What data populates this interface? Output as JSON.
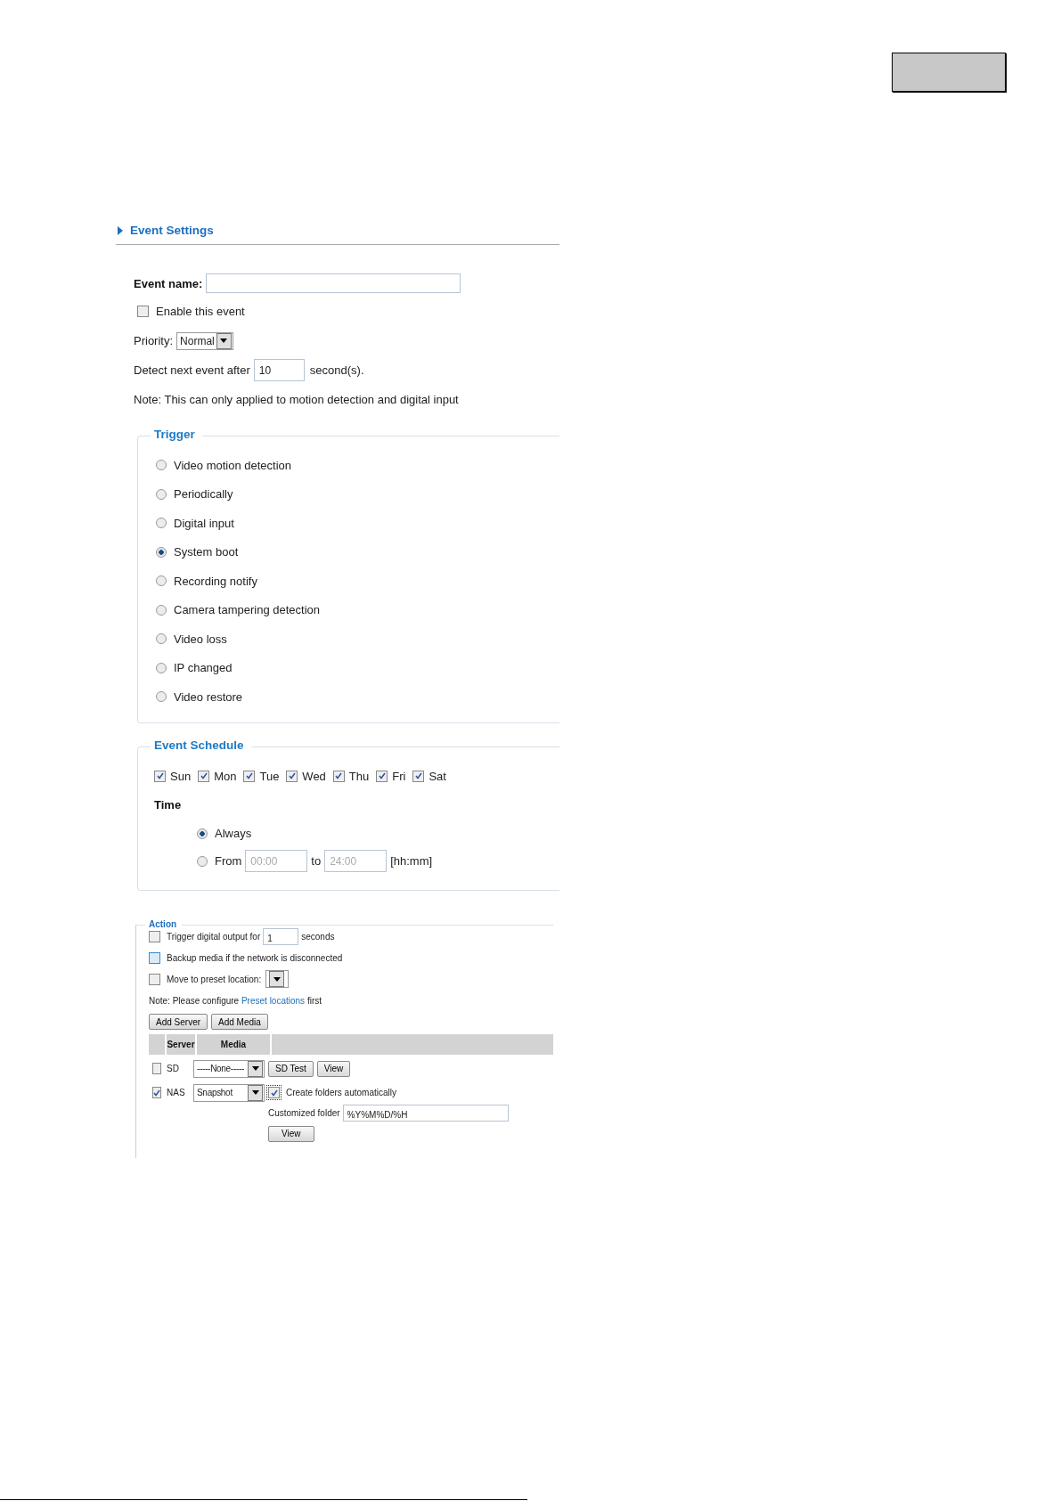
{
  "header": {
    "title": "Event Settings"
  },
  "event_name": {
    "label": "Event name:"
  },
  "enable_event": {
    "label": "Enable this event",
    "checked": false
  },
  "priority": {
    "label": "Priority:",
    "value": "Normal"
  },
  "detect_next": {
    "label": "Detect next event after",
    "value": "10",
    "unit": "second(s)."
  },
  "note": "Note: This can only applied to motion detection and digital input",
  "trigger": {
    "title": "Trigger",
    "options": [
      {
        "label": "Video motion detection",
        "selected": false
      },
      {
        "label": "Periodically",
        "selected": false
      },
      {
        "label": "Digital input",
        "selected": false
      },
      {
        "label": "System boot",
        "selected": true
      },
      {
        "label": "Recording notify",
        "selected": false
      },
      {
        "label": "Camera tampering detection",
        "selected": false
      },
      {
        "label": "Video loss",
        "selected": false
      },
      {
        "label": "IP changed",
        "selected": false
      },
      {
        "label": "Video restore",
        "selected": false
      }
    ]
  },
  "schedule": {
    "title": "Event Schedule",
    "days": [
      {
        "label": "Sun",
        "checked": true
      },
      {
        "label": "Mon",
        "checked": true
      },
      {
        "label": "Tue",
        "checked": true
      },
      {
        "label": "Wed",
        "checked": true
      },
      {
        "label": "Thu",
        "checked": true
      },
      {
        "label": "Fri",
        "checked": true
      },
      {
        "label": "Sat",
        "checked": true
      }
    ],
    "time_label": "Time",
    "modes": [
      {
        "kind": "always",
        "label": "Always",
        "selected": true
      },
      {
        "kind": "range",
        "label": "From",
        "selected": false,
        "from": "00:00",
        "to_label": "to",
        "to": "24:00",
        "format": "[hh:mm]"
      }
    ]
  },
  "action": {
    "title": "Action",
    "options": [
      {
        "kind": "duration",
        "label": "Trigger digital output for",
        "checked": false,
        "highlighted": false,
        "value": "1",
        "unit": "seconds"
      },
      {
        "kind": "plain",
        "label": "Backup media if the network is disconnected",
        "checked": false,
        "highlighted": true
      },
      {
        "kind": "dropdown",
        "label": "Move to preset location:",
        "checked": false,
        "highlighted": false
      }
    ],
    "note_before": "Note: Please configure",
    "note_link": "Preset locations",
    "note_after": "first",
    "buttons": [
      "Add Server",
      "Add Media"
    ],
    "table": {
      "columns": [
        "Server",
        "Media"
      ],
      "rows": [
        {
          "kind": "sd",
          "checked": false,
          "server": "SD",
          "media": "-----None-----",
          "buttons": [
            "SD Test",
            "View"
          ]
        },
        {
          "kind": "nas",
          "checked": true,
          "server": "NAS",
          "media": "Snapshot",
          "create_folders": {
            "label": "Create folders automatically",
            "checked": true
          },
          "folder_label": "Customized folder",
          "folder_value": "%Y%M%D/%H",
          "buttons": [
            "View"
          ]
        }
      ]
    }
  }
}
